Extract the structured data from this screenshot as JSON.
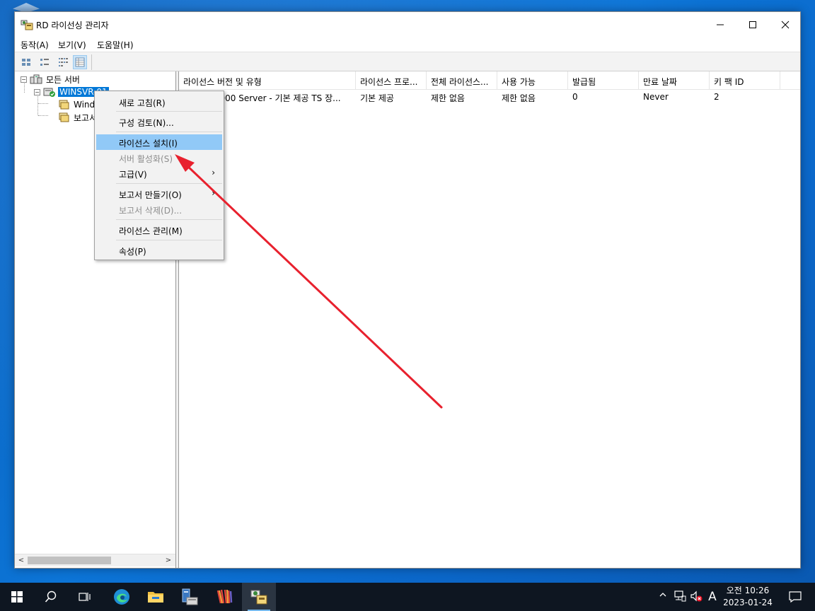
{
  "window": {
    "title": "RD 라이선싱 관리자"
  },
  "menu": [
    "동작(A)",
    "보기(V)",
    "도움말(H)"
  ],
  "toolbar": {
    "icons": [
      "large-icons-view-icon",
      "small-icons-view-icon",
      "list-view-icon",
      "details-view-icon"
    ]
  },
  "tree": {
    "root": "모든 서버",
    "server": "WINSVR-01",
    "child1": "Wind",
    "child2": "보고서"
  },
  "list": {
    "columns": [
      "라이선스 버전 및 유형",
      "라이선스 프로...",
      "전체 라이선스...",
      "사용 가능",
      "발급됨",
      "만료 날짜",
      "키 팩 ID"
    ],
    "rows": [
      [
        "ws 2000 Server - 기본 제공 TS 장...",
        "기본 제공",
        "제한 없음",
        "제한 없음",
        "0",
        "Never",
        "2"
      ]
    ]
  },
  "context_menu": {
    "items": [
      {
        "label": "새로 고침(R)",
        "disabled": false,
        "highlighted": false
      },
      {
        "label": "구성 검토(N)...",
        "disabled": false,
        "highlighted": false
      },
      {
        "label": "라이선스 설치(I)",
        "disabled": false,
        "highlighted": true
      },
      {
        "label": "서버 활성화(S)",
        "disabled": true,
        "highlighted": false
      },
      {
        "label": "고급(V)",
        "disabled": false,
        "highlighted": false,
        "submenu": true
      },
      {
        "label": "보고서 만들기(O)",
        "disabled": false,
        "highlighted": false,
        "submenu": true
      },
      {
        "label": "보고서 삭제(D)...",
        "disabled": true,
        "highlighted": false
      },
      {
        "label": "라이선스 관리(M)",
        "disabled": false,
        "highlighted": false
      },
      {
        "label": "속성(P)",
        "disabled": false,
        "highlighted": false
      }
    ],
    "submenu_glyph": "›"
  },
  "taskbar": {
    "apps": [
      "start-icon",
      "search-icon",
      "task-view-icon",
      "edge-icon",
      "file-explorer-icon",
      "server-manager-icon",
      "winrar-icon",
      "rd-licensing-icon"
    ],
    "ime": "A",
    "time": "오전 10:26",
    "date": "2023-01-24"
  },
  "colors": {
    "accent": "#0078d7",
    "menu_highlight": "#91c9f7",
    "annotation_arrow": "#e8212e",
    "desktop": "#0b6ed0",
    "taskbar": "#0e1621"
  }
}
